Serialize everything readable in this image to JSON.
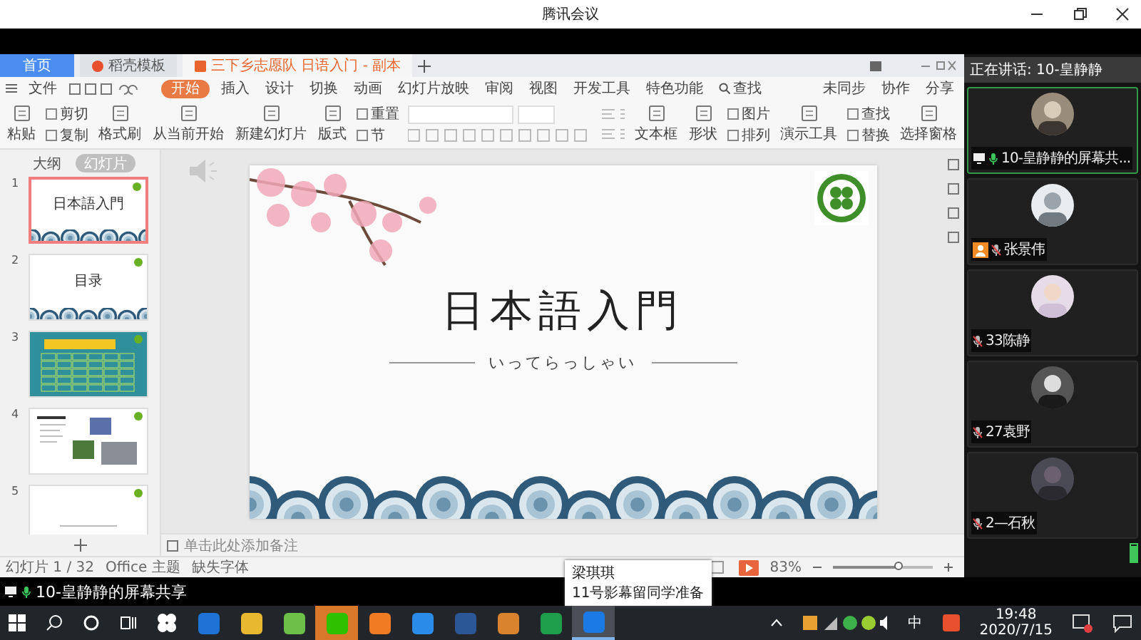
{
  "meeting_window": {
    "title": "腾讯会议"
  },
  "wps": {
    "tabs": [
      {
        "label": "首页",
        "kind": "home",
        "selected": false
      },
      {
        "label": "稻壳模板",
        "kind": "template",
        "selected": false
      },
      {
        "label": "三下乡志愿队 日语入门 - 副本",
        "kind": "document",
        "selected": true
      }
    ],
    "menu": [
      {
        "label": "文件",
        "selected": false
      },
      {
        "label": "开始",
        "selected": true
      },
      {
        "label": "插入",
        "selected": false
      },
      {
        "label": "设计",
        "selected": false
      },
      {
        "label": "切换",
        "selected": false
      },
      {
        "label": "动画",
        "selected": false
      },
      {
        "label": "幻灯片放映",
        "selected": false
      },
      {
        "label": "审阅",
        "selected": false
      },
      {
        "label": "视图",
        "selected": false
      },
      {
        "label": "开发工具",
        "selected": false
      },
      {
        "label": "特色功能",
        "selected": false
      }
    ],
    "search_label": "查找",
    "account_actions": [
      "未同步",
      "协作",
      "分享"
    ],
    "ribbon": [
      {
        "kind": "large",
        "label": "粘贴"
      },
      {
        "kind": "stack",
        "items": [
          "剪切",
          "复制"
        ]
      },
      {
        "kind": "large",
        "label": "格式刷"
      },
      {
        "kind": "large",
        "label": "从当前开始"
      },
      {
        "kind": "large",
        "label": "新建幻灯片"
      },
      {
        "kind": "large",
        "label": "版式"
      },
      {
        "kind": "stack",
        "items": [
          "重置",
          "节"
        ]
      },
      {
        "kind": "font"
      },
      {
        "kind": "large",
        "label": "文本框"
      },
      {
        "kind": "large",
        "label": "形状"
      },
      {
        "kind": "stack",
        "items": [
          "图片",
          "排列"
        ]
      },
      {
        "kind": "large",
        "label": "演示工具"
      },
      {
        "kind": "stack",
        "items": [
          "查找",
          "替换"
        ]
      },
      {
        "kind": "large",
        "label": "选择窗格"
      }
    ],
    "pane_tabs": [
      {
        "label": "大纲",
        "selected": false
      },
      {
        "label": "幻灯片",
        "selected": true
      }
    ],
    "thumbnails": [
      {
        "number": "1",
        "kind": "title",
        "title": "日本語入門",
        "selected": true
      },
      {
        "number": "2",
        "kind": "contents",
        "title": "目录",
        "selected": false
      },
      {
        "number": "3",
        "kind": "table",
        "selected": false
      },
      {
        "number": "4",
        "kind": "photos",
        "selected": false
      },
      {
        "number": "5",
        "kind": "text",
        "selected": false
      }
    ],
    "slide": {
      "title": "日本語入門",
      "subtitle": "いってらっしゃい"
    },
    "notes_placeholder": "单击此处添加备注",
    "status": [
      "幻灯片 1 / 32",
      "Office 主题",
      "缺失字体"
    ],
    "zoom": {
      "reading": "83%",
      "level": 0.65
    }
  },
  "meeting": {
    "speaking": "正在讲话: 10-皇静静",
    "participants": [
      {
        "name": "10-皇静静的屏幕共...",
        "screen_sharing": true,
        "mic_on": true,
        "is_host": false,
        "selected": true
      },
      {
        "name": "张景伟",
        "screen_sharing": false,
        "mic_on": false,
        "is_host": true,
        "selected": false
      },
      {
        "name": "33陈静",
        "screen_sharing": false,
        "mic_on": false,
        "is_host": false,
        "selected": false
      },
      {
        "name": "27袁野",
        "screen_sharing": false,
        "mic_on": false,
        "is_host": false,
        "selected": false
      },
      {
        "name": "2—石秋",
        "screen_sharing": false,
        "mic_on": false,
        "is_host": false,
        "selected": false
      }
    ],
    "mic_meter": {
      "level": 0.9
    },
    "share_bar": "10-皇静静的屏幕共享"
  },
  "taskbar": {
    "apps": [
      {
        "color": "#1f73d6",
        "flashing": false,
        "selected": false
      },
      {
        "color": "#e8b830",
        "flashing": false,
        "selected": false
      },
      {
        "color": "#6cc04a",
        "flashing": false,
        "selected": false
      },
      {
        "color": "#2dc100",
        "flashing": true,
        "selected": false
      },
      {
        "color": "#f07b22",
        "flashing": false,
        "selected": false
      },
      {
        "color": "#2a8ce8",
        "flashing": false,
        "selected": false
      },
      {
        "color": "#2b5797",
        "flashing": false,
        "selected": false
      },
      {
        "color": "#d9832e",
        "flashing": false,
        "selected": false
      },
      {
        "color": "#1e9e4a",
        "flashing": false,
        "selected": false
      },
      {
        "color": "#1c7ae6",
        "flashing": false,
        "selected": true
      }
    ],
    "tooltip": [
      "梁琪琪",
      "11号影幕留同学准备"
    ],
    "ime": "中",
    "time": "19:48",
    "date": "2020/7/15"
  }
}
